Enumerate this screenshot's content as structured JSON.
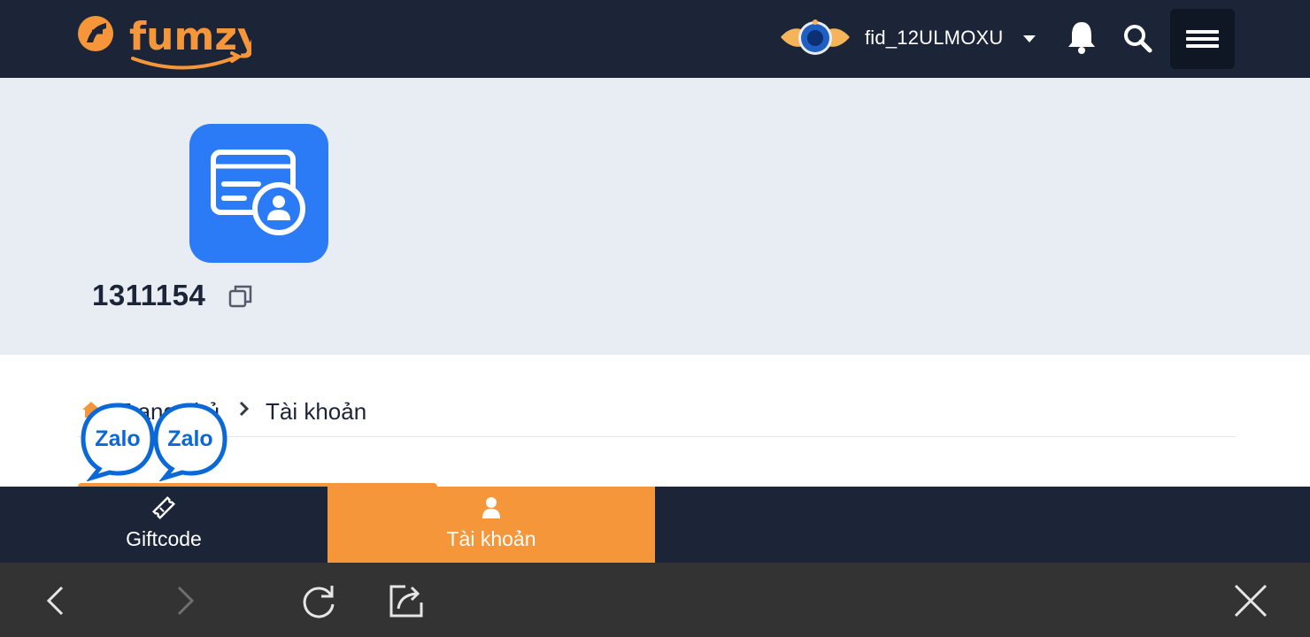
{
  "header": {
    "logo_text": "fumzy",
    "username": "fid_12ULMOXU",
    "icons": {
      "logo": "fumzy-logo",
      "avatar": "avatar-frame-icon",
      "caret": "caret-down-icon",
      "bell": "bell-icon",
      "search": "search-icon",
      "menu": "hamburger-menu-icon"
    }
  },
  "profile": {
    "account_id": "1311154",
    "icons": {
      "card": "id-card-icon",
      "copy": "copy-icon"
    }
  },
  "breadcrumb": {
    "home_label": "Trang chủ",
    "current_label": "Tài khoản",
    "icons": {
      "home": "home-icon",
      "separator": "chevron-right-icon"
    }
  },
  "floating": {
    "zalo_label_1": "Zalo",
    "zalo_label_2": "Zalo"
  },
  "tabs": [
    {
      "label": "Giftcode",
      "icon": "ticket-icon",
      "active": false
    },
    {
      "label": "Tài khoản",
      "icon": "user-icon",
      "active": true
    }
  ],
  "browser": {
    "icons": [
      "back-icon",
      "forward-icon",
      "reload-icon",
      "share-icon",
      "close-icon"
    ]
  },
  "colors": {
    "header_bg": "#1b2537",
    "accent": "#f5963a",
    "profile_bg": "#e8edf4",
    "icon_blue": "#2b7bf6",
    "browser_bg": "#333333"
  }
}
